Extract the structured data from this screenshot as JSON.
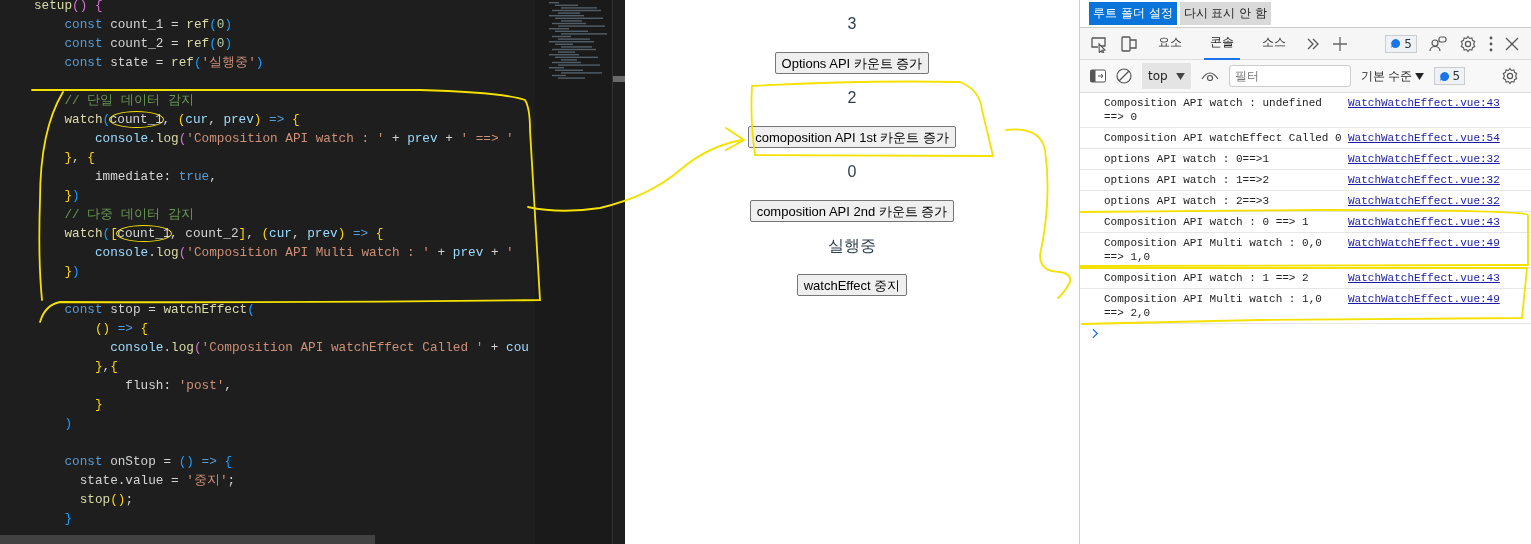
{
  "editor": {
    "lines": [
      {
        "kind": "code",
        "tokens": [
          {
            "text": "setup",
            "kind": "fn"
          },
          {
            "text": "() {",
            "kind": "br2"
          }
        ]
      },
      {
        "kind": "code",
        "tokens": [
          {
            "text": "    const",
            "kind": "kw"
          },
          {
            "text": " count_1 = ",
            "kind": "id"
          },
          {
            "text": "ref",
            "kind": "fn"
          },
          {
            "text": "(",
            "kind": "br3"
          },
          {
            "text": "0",
            "kind": "num"
          },
          {
            "text": ")",
            "kind": "br3"
          }
        ]
      },
      {
        "kind": "code",
        "tokens": [
          {
            "text": "    const",
            "kind": "kw"
          },
          {
            "text": " count_2 = ",
            "kind": "id"
          },
          {
            "text": "ref",
            "kind": "fn"
          },
          {
            "text": "(",
            "kind": "br3"
          },
          {
            "text": "0",
            "kind": "num"
          },
          {
            "text": ")",
            "kind": "br3"
          }
        ]
      },
      {
        "kind": "code",
        "tokens": [
          {
            "text": "    const",
            "kind": "kw"
          },
          {
            "text": " state = ",
            "kind": "id"
          },
          {
            "text": "ref",
            "kind": "fn"
          },
          {
            "text": "(",
            "kind": "br3"
          },
          {
            "text": "'실행중'",
            "kind": "str"
          },
          {
            "text": ")",
            "kind": "br3"
          }
        ]
      },
      {
        "kind": "blank"
      },
      {
        "kind": "code",
        "tokens": [
          {
            "text": "    // 단일 데이터 감지",
            "kind": "com"
          }
        ]
      },
      {
        "kind": "code",
        "tokens": [
          {
            "text": "    watch",
            "kind": "fn"
          },
          {
            "text": "(",
            "kind": "br3"
          },
          {
            "text": "count_1",
            "kind": "id",
            "circled": true
          },
          {
            "text": ", ",
            "kind": "op"
          },
          {
            "text": "(",
            "kind": "br1"
          },
          {
            "text": "cur",
            "kind": "param"
          },
          {
            "text": ", ",
            "kind": "op"
          },
          {
            "text": "prev",
            "kind": "param"
          },
          {
            "text": ")",
            "kind": "br1"
          },
          {
            "text": " => ",
            "kind": "kw"
          },
          {
            "text": "{",
            "kind": "br1"
          }
        ]
      },
      {
        "kind": "code",
        "tokens": [
          {
            "text": "        console",
            "kind": "param"
          },
          {
            "text": ".",
            "kind": "op"
          },
          {
            "text": "log",
            "kind": "fn"
          },
          {
            "text": "(",
            "kind": "br2"
          },
          {
            "text": "'Composition API watch : '",
            "kind": "str"
          },
          {
            "text": " + ",
            "kind": "op"
          },
          {
            "text": "prev",
            "kind": "param"
          },
          {
            "text": " + ",
            "kind": "op"
          },
          {
            "text": "' ==> '",
            "kind": "str"
          }
        ]
      },
      {
        "kind": "code",
        "tokens": [
          {
            "text": "    }",
            "kind": "br1"
          },
          {
            "text": ", ",
            "kind": "op"
          },
          {
            "text": "{",
            "kind": "br1"
          }
        ]
      },
      {
        "kind": "code",
        "tokens": [
          {
            "text": "        immediate: ",
            "kind": "id"
          },
          {
            "text": "true",
            "kind": "kw"
          },
          {
            "text": ",",
            "kind": "op"
          }
        ]
      },
      {
        "kind": "code",
        "tokens": [
          {
            "text": "    }",
            "kind": "br1"
          },
          {
            "text": ")",
            "kind": "br3"
          }
        ]
      },
      {
        "kind": "code",
        "tokens": [
          {
            "text": "    // 다중 데이터 감지",
            "kind": "com"
          }
        ]
      },
      {
        "kind": "code",
        "tokens": [
          {
            "text": "    watch",
            "kind": "fn"
          },
          {
            "text": "(",
            "kind": "br3"
          },
          {
            "text": "[",
            "kind": "br1"
          },
          {
            "text": "count_1",
            "kind": "id",
            "circled": true
          },
          {
            "text": ", count_2",
            "kind": "id"
          },
          {
            "text": "]",
            "kind": "br1"
          },
          {
            "text": ", ",
            "kind": "op"
          },
          {
            "text": "(",
            "kind": "br1"
          },
          {
            "text": "cur",
            "kind": "param"
          },
          {
            "text": ", ",
            "kind": "op"
          },
          {
            "text": "prev",
            "kind": "param"
          },
          {
            "text": ")",
            "kind": "br1"
          },
          {
            "text": " => ",
            "kind": "kw"
          },
          {
            "text": "{",
            "kind": "br1"
          }
        ]
      },
      {
        "kind": "code",
        "tokens": [
          {
            "text": "        console",
            "kind": "param"
          },
          {
            "text": ".",
            "kind": "op"
          },
          {
            "text": "log",
            "kind": "fn"
          },
          {
            "text": "(",
            "kind": "br2"
          },
          {
            "text": "'Composition API Multi watch : '",
            "kind": "str"
          },
          {
            "text": " + ",
            "kind": "op"
          },
          {
            "text": "prev",
            "kind": "param"
          },
          {
            "text": " + ",
            "kind": "op"
          },
          {
            "text": "'",
            "kind": "str"
          }
        ]
      },
      {
        "kind": "code",
        "tokens": [
          {
            "text": "    }",
            "kind": "br1"
          },
          {
            "text": ")",
            "kind": "br3"
          }
        ]
      },
      {
        "kind": "blank"
      },
      {
        "kind": "code",
        "tokens": [
          {
            "text": "    const",
            "kind": "kw"
          },
          {
            "text": " stop = ",
            "kind": "id"
          },
          {
            "text": "watchEffect",
            "kind": "fn"
          },
          {
            "text": "(",
            "kind": "br3"
          }
        ]
      },
      {
        "kind": "code",
        "tokens": [
          {
            "text": "        ()",
            "kind": "br1"
          },
          {
            "text": " => ",
            "kind": "kw"
          },
          {
            "text": "{",
            "kind": "br1"
          }
        ]
      },
      {
        "kind": "code",
        "tokens": [
          {
            "text": "          console",
            "kind": "param"
          },
          {
            "text": ".",
            "kind": "op"
          },
          {
            "text": "log",
            "kind": "fn"
          },
          {
            "text": "(",
            "kind": "br2"
          },
          {
            "text": "'Composition API watchEffect Called '",
            "kind": "str"
          },
          {
            "text": " + ",
            "kind": "op"
          },
          {
            "text": "cou",
            "kind": "param"
          }
        ]
      },
      {
        "kind": "code",
        "tokens": [
          {
            "text": "        }",
            "kind": "br1"
          },
          {
            "text": ",",
            "kind": "op"
          },
          {
            "text": "{",
            "kind": "br1"
          }
        ]
      },
      {
        "kind": "code",
        "tokens": [
          {
            "text": "            flush: ",
            "kind": "id"
          },
          {
            "text": "'post'",
            "kind": "str"
          },
          {
            "text": ",",
            "kind": "op"
          }
        ]
      },
      {
        "kind": "code",
        "tokens": [
          {
            "text": "        }",
            "kind": "br1"
          }
        ]
      },
      {
        "kind": "code",
        "tokens": [
          {
            "text": "    )",
            "kind": "br3"
          }
        ]
      },
      {
        "kind": "blank"
      },
      {
        "kind": "code",
        "tokens": [
          {
            "text": "    const",
            "kind": "kw"
          },
          {
            "text": " onStop = ",
            "kind": "id"
          },
          {
            "text": "()",
            "kind": "br3"
          },
          {
            "text": " => ",
            "kind": "kw"
          },
          {
            "text": "{",
            "kind": "br3"
          }
        ]
      },
      {
        "kind": "code",
        "tokens": [
          {
            "text": "      state.value = ",
            "kind": "id"
          },
          {
            "text": "'중지'",
            "kind": "str"
          },
          {
            "text": ";",
            "kind": "op"
          }
        ]
      },
      {
        "kind": "code",
        "tokens": [
          {
            "text": "      stop",
            "kind": "fn"
          },
          {
            "text": "()",
            "kind": "br1"
          },
          {
            "text": ";",
            "kind": "op"
          }
        ]
      },
      {
        "kind": "code",
        "tokens": [
          {
            "text": "    }",
            "kind": "br3"
          }
        ]
      }
    ]
  },
  "preview": {
    "items": [
      {
        "kind": "text",
        "text": "3"
      },
      {
        "kind": "button",
        "text": "Options API 카운트 증가"
      },
      {
        "kind": "text",
        "text": "2"
      },
      {
        "kind": "button",
        "text": "comoposition API 1st 카운트 증가"
      },
      {
        "kind": "text",
        "text": "0"
      },
      {
        "kind": "button",
        "text": "composition API 2nd 카운트 증가"
      },
      {
        "kind": "text",
        "text": "실행중"
      },
      {
        "kind": "button",
        "text": "watchEffect 중지"
      }
    ]
  },
  "devtools": {
    "notice_buttons": [
      {
        "label": "루트 폴더 설정",
        "primary": true
      },
      {
        "label": "다시 표시 안 함",
        "primary": false
      }
    ],
    "tabs": [
      {
        "label": "요소",
        "selected": false
      },
      {
        "label": "콘솔",
        "selected": true
      },
      {
        "label": "소스",
        "selected": false
      }
    ],
    "issues_badge": "5",
    "context": "top",
    "filter": {
      "placeholder": "필터"
    },
    "level_filter": "기본 수준",
    "messages_badge": "5",
    "console": [
      {
        "message": "Composition API watch : undefined ==> 0",
        "source": "WatchWatchEffect.vue:43"
      },
      {
        "message": "Composition API watchEffect Called 0",
        "source": "WatchWatchEffect.vue:54"
      },
      {
        "message": "options API watch : 0==>1",
        "source": "WatchWatchEffect.vue:32"
      },
      {
        "message": "options API watch : 1==>2",
        "source": "WatchWatchEffect.vue:32"
      },
      {
        "message": "options API watch : 2==>3",
        "source": "WatchWatchEffect.vue:32"
      },
      {
        "message": "Composition API watch : 0 ==> 1",
        "source": "WatchWatchEffect.vue:43"
      },
      {
        "message": "Composition API Multi watch : 0,0 ==> 1,0",
        "source": "WatchWatchEffect.vue:49"
      },
      {
        "message": "Composition API watch : 1 ==> 2",
        "source": "WatchWatchEffect.vue:43"
      },
      {
        "message": "Composition API Multi watch : 1,0 ==> 2,0",
        "source": "WatchWatchEffect.vue:49"
      }
    ]
  }
}
